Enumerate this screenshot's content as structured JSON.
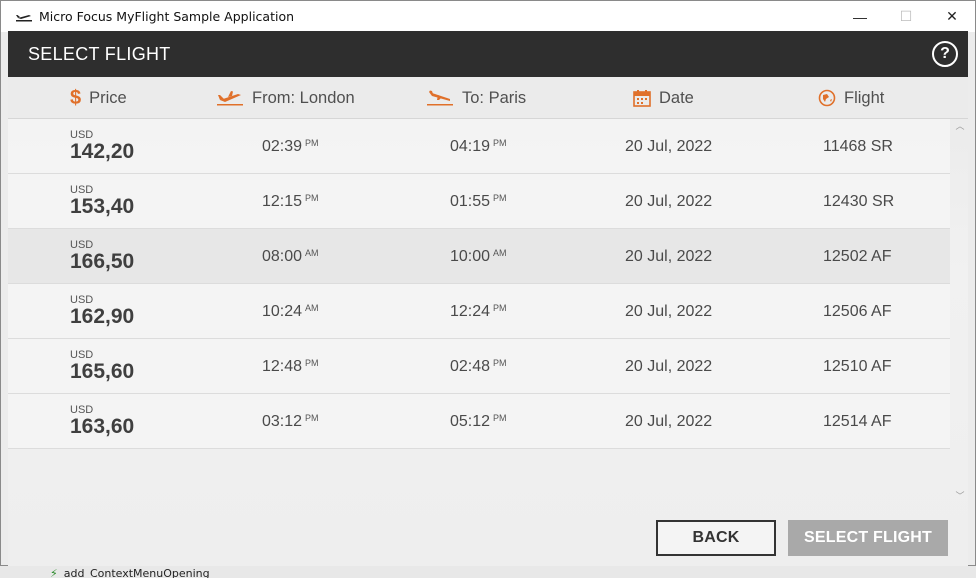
{
  "window": {
    "title": "Micro Focus MyFlight Sample Application",
    "controls": {
      "minimize": "—",
      "maximize": "☐",
      "close": "✕"
    }
  },
  "header": {
    "title": "SELECT FLIGHT",
    "help_label": "?"
  },
  "columns": {
    "price": "Price",
    "from": "From: London",
    "to": "To: Paris",
    "date": "Date",
    "flight": "Flight"
  },
  "flights": [
    {
      "currency": "USD",
      "price": "142,20",
      "depart": "02:39",
      "depart_ampm": "PM",
      "arrive": "04:19",
      "arrive_ampm": "PM",
      "date": "20 Jul, 2022",
      "flight": "11468 SR"
    },
    {
      "currency": "USD",
      "price": "153,40",
      "depart": "12:15",
      "depart_ampm": "PM",
      "arrive": "01:55",
      "arrive_ampm": "PM",
      "date": "20 Jul, 2022",
      "flight": "12430 SR"
    },
    {
      "currency": "USD",
      "price": "166,50",
      "depart": "08:00",
      "depart_ampm": "AM",
      "arrive": "10:00",
      "arrive_ampm": "AM",
      "date": "20 Jul, 2022",
      "flight": "12502 AF"
    },
    {
      "currency": "USD",
      "price": "162,90",
      "depart": "10:24",
      "depart_ampm": "AM",
      "arrive": "12:24",
      "arrive_ampm": "PM",
      "date": "20 Jul, 2022",
      "flight": "12506 AF"
    },
    {
      "currency": "USD",
      "price": "165,60",
      "depart": "12:48",
      "depart_ampm": "PM",
      "arrive": "02:48",
      "arrive_ampm": "PM",
      "date": "20 Jul, 2022",
      "flight": "12510 AF"
    },
    {
      "currency": "USD",
      "price": "163,60",
      "depart": "03:12",
      "depart_ampm": "PM",
      "arrive": "05:12",
      "arrive_ampm": "PM",
      "date": "20 Jul, 2022",
      "flight": "12514 AF"
    }
  ],
  "buttons": {
    "back": "BACK",
    "select": "SELECT FLIGHT"
  },
  "background": {
    "bottom_text": "add_ContextMenuOpening"
  },
  "icons": {
    "price": "dollar-icon",
    "from": "takeoff-icon",
    "to": "landing-icon",
    "date": "calendar-icon",
    "flight": "globe-icon"
  },
  "colors": {
    "accent": "#e0702a",
    "header_bg": "#2e2e2e",
    "select_btn_disabled": "#a9a9a9"
  }
}
